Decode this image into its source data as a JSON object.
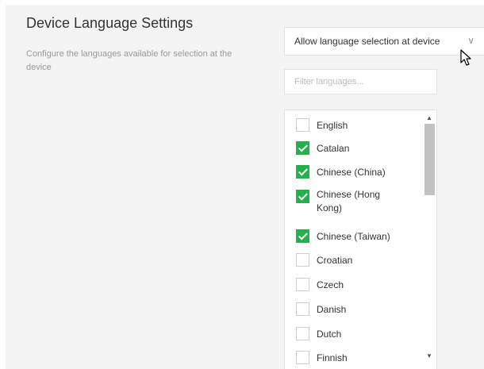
{
  "header": {
    "title": "Device Language Settings",
    "description": "Configure the languages available for selection at the device"
  },
  "mode_select": {
    "value": "Allow language selection at device",
    "icon": "chevron-down-icon"
  },
  "filter": {
    "placeholder": "Filter languages..."
  },
  "languages": [
    {
      "label": "English",
      "checked": false
    },
    {
      "label": "Catalan",
      "checked": true
    },
    {
      "label": "Chinese (China)",
      "checked": true
    },
    {
      "label": "Chinese (Hong Kong)",
      "checked": true
    },
    {
      "label": "Chinese (Taiwan)",
      "checked": true
    },
    {
      "label": "Croatian",
      "checked": false
    },
    {
      "label": "Czech",
      "checked": false
    },
    {
      "label": "Danish",
      "checked": false
    },
    {
      "label": "Dutch",
      "checked": false
    },
    {
      "label": "Finnish",
      "checked": false
    }
  ],
  "colors": {
    "checked": "#22b14c",
    "panel": "#f4f4f4"
  }
}
